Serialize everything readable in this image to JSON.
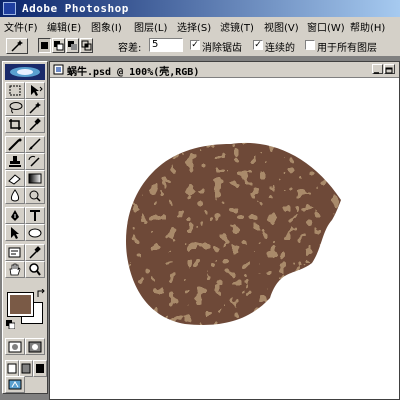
{
  "app": {
    "title": "Adobe Photoshop"
  },
  "menu": [
    "文件(F)",
    "编辑(E)",
    "图象(I)",
    "图层(L)",
    "选择(S)",
    "滤镜(T)",
    "视图(V)",
    "窗口(W)",
    "帮助(H)"
  ],
  "options": {
    "tolerance_label": "容差:",
    "tolerance_value": "5",
    "antialias_label": "消除锯齿",
    "contiguous_label": "连续的",
    "all_layers_label": "用于所有图层"
  },
  "document": {
    "title": "蜗牛.psd @ 100%(壳,RGB)"
  },
  "colors": {
    "foreground": "#7a5a46",
    "background": "#ffffff",
    "shell_light": "#a98a6a",
    "shell_dark": "#6e4a38"
  },
  "icons": [
    "magic-wand-icon",
    "selection-mode-icon",
    "marquee-icon",
    "move-icon",
    "lasso-icon",
    "crop-icon",
    "eyedropper-icon",
    "brush-icon",
    "stamp-icon",
    "eraser-icon",
    "gradient-icon",
    "blur-icon",
    "pen-icon",
    "type-icon",
    "hand-icon",
    "zoom-icon"
  ]
}
